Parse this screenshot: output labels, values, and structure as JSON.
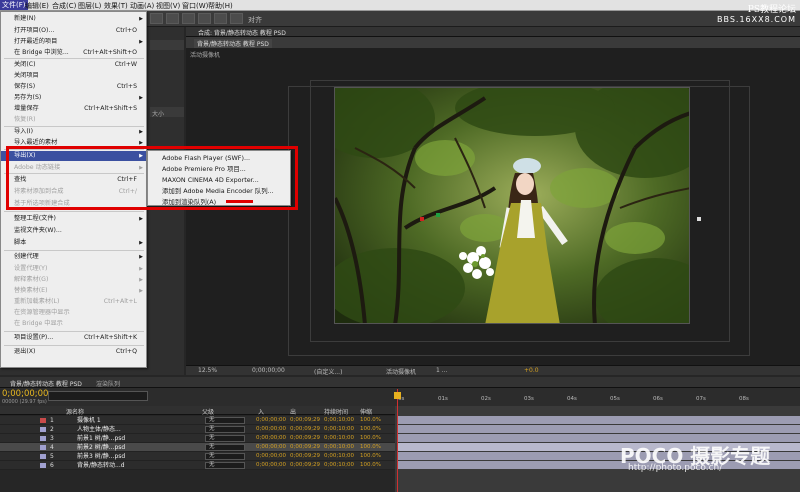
{
  "menubar": {
    "items": [
      "文件(F)",
      "编辑(E)",
      "合成(C)",
      "图层(L)",
      "效果(T)",
      "动画(A)",
      "视图(V)",
      "窗口(W)",
      "帮助(H)"
    ]
  },
  "toolbar": {
    "align_label": "对齐"
  },
  "file_menu": {
    "items": [
      {
        "label": "新建(N)",
        "shortcut": "",
        "submenu": true,
        "disabled": false
      },
      {
        "label": "打开项目(O)...",
        "shortcut": "Ctrl+O",
        "submenu": false,
        "disabled": false
      },
      {
        "label": "打开最近的项目",
        "shortcut": "",
        "submenu": true,
        "disabled": false
      },
      {
        "label": "在 Bridge 中浏览...",
        "shortcut": "Ctrl+Alt+Shift+O",
        "submenu": false,
        "disabled": false
      },
      {
        "label": "关闭(C)",
        "shortcut": "Ctrl+W",
        "submenu": false,
        "disabled": false
      },
      {
        "label": "关闭项目",
        "shortcut": "",
        "submenu": false,
        "disabled": false
      },
      {
        "label": "保存(S)",
        "shortcut": "Ctrl+S",
        "submenu": false,
        "disabled": false
      },
      {
        "label": "另存为(S)",
        "shortcut": "",
        "submenu": true,
        "disabled": false
      },
      {
        "label": "增量保存",
        "shortcut": "Ctrl+Alt+Shift+S",
        "submenu": false,
        "disabled": false
      },
      {
        "label": "恢复(R)",
        "shortcut": "",
        "submenu": false,
        "disabled": true
      },
      {
        "label": "导入(I)",
        "shortcut": "",
        "submenu": true,
        "disabled": false
      },
      {
        "label": "导入最近的素材",
        "shortcut": "",
        "submenu": true,
        "disabled": false
      },
      {
        "label": "导出(X)",
        "shortcut": "",
        "submenu": true,
        "disabled": false,
        "highlighted": true
      },
      {
        "label": "Adobe 动态链接",
        "shortcut": "",
        "submenu": true,
        "disabled": true
      },
      {
        "label": "查找",
        "shortcut": "Ctrl+F",
        "submenu": false,
        "disabled": false
      },
      {
        "label": "将素材添加到合成",
        "shortcut": "Ctrl+/",
        "submenu": false,
        "disabled": true
      },
      {
        "label": "基于所选项新建合成",
        "shortcut": "",
        "submenu": false,
        "disabled": true
      },
      {
        "label": "整理工程(文件)",
        "shortcut": "",
        "submenu": true,
        "disabled": false
      },
      {
        "label": "监视文件夹(W)...",
        "shortcut": "",
        "submenu": false,
        "disabled": false
      },
      {
        "label": "脚本",
        "shortcut": "",
        "submenu": true,
        "disabled": false
      },
      {
        "label": "创建代理",
        "shortcut": "",
        "submenu": true,
        "disabled": false
      },
      {
        "label": "设置代理(Y)",
        "shortcut": "",
        "submenu": true,
        "disabled": true
      },
      {
        "label": "解释素材(G)",
        "shortcut": "",
        "submenu": true,
        "disabled": true
      },
      {
        "label": "替换素材(E)",
        "shortcut": "",
        "submenu": true,
        "disabled": true
      },
      {
        "label": "重新加载素材(L)",
        "shortcut": "Ctrl+Alt+L",
        "submenu": false,
        "disabled": true
      },
      {
        "label": "在资源管理器中显示",
        "shortcut": "",
        "submenu": false,
        "disabled": true
      },
      {
        "label": "在 Bridge 中显示",
        "shortcut": "",
        "submenu": false,
        "disabled": true
      },
      {
        "label": "项目设置(P)...",
        "shortcut": "Ctrl+Alt+Shift+K",
        "submenu": false,
        "disabled": false
      },
      {
        "label": "退出(X)",
        "shortcut": "Ctrl+Q",
        "submenu": false,
        "disabled": false
      }
    ]
  },
  "export_submenu": {
    "items": [
      "Adobe Flash Player (SWF)...",
      "Adobe Premiere Pro 项目...",
      "MAXON CINEMA 4D Exporter...",
      "添加到 Adobe Media Encoder 队列...",
      "添加到渲染队列(A)"
    ]
  },
  "left_panel": {
    "size_label": "大小"
  },
  "composition": {
    "tab_title": "合成: 背景/静态转动态 教程 PSD",
    "subtab_1": "背景/静态转动态 教程 PSD",
    "camera_label": "活动摄像机",
    "zoom": "12.5%",
    "timecode": "0;00;00;00",
    "quality": "(自定义...)",
    "view": "活动摄像机",
    "views_count": "1 ...",
    "exposure": "+0.0"
  },
  "timeline": {
    "tab_title": "背景/静态转动态 教程 PSD",
    "render_tab": "渲染队列",
    "current_time": "0;00;00;00",
    "frames": "00000 (29.97 fps)",
    "columns": {
      "name": "源名称",
      "parent": "父级",
      "in": "入",
      "out": "出",
      "duration": "持续时间",
      "stretch": "伸缩"
    },
    "ruler": [
      "0s",
      "01s",
      "02s",
      "03s",
      "04s",
      "05s",
      "06s",
      "07s",
      "08s"
    ],
    "layers": [
      {
        "num": "1",
        "name": "摄像机 1",
        "color": "#c84a4a",
        "parent": "无",
        "in": "0;00;00;00",
        "out": "0;00;09;29",
        "duration": "0;00;10;00",
        "stretch": "100.0%"
      },
      {
        "num": "2",
        "name": "人物主体/静态...",
        "color": "#a0a0d0",
        "parent": "无",
        "in": "0;00;00;00",
        "out": "0;00;09;29",
        "duration": "0;00;10;00",
        "stretch": "100.0%"
      },
      {
        "num": "3",
        "name": "前景1 树/静...psd",
        "color": "#a0a0d0",
        "parent": "无",
        "in": "0;00;00;00",
        "out": "0;00;09;29",
        "duration": "0;00;10;00",
        "stretch": "100.0%"
      },
      {
        "num": "4",
        "name": "前景2 树/静...psd",
        "color": "#a0a0d0",
        "parent": "无",
        "in": "0;00;00;00",
        "out": "0;00;09;29",
        "duration": "0;00;10;00",
        "stretch": "100.0%"
      },
      {
        "num": "5",
        "name": "前景3 树/静...psd",
        "color": "#a0a0d0",
        "parent": "无",
        "in": "0;00;00;00",
        "out": "0;00;09;29",
        "duration": "0;00;10;00",
        "stretch": "100.0%"
      },
      {
        "num": "6",
        "name": "背景/静态转动...d",
        "color": "#a0a0d0",
        "parent": "无",
        "in": "0;00;00;00",
        "out": "0;00;09;29",
        "duration": "0;00;10;00",
        "stretch": "100.0%"
      }
    ]
  },
  "watermark_top": {
    "line1": "PS教程论坛",
    "line2": "BBS.16XX8.COM"
  },
  "watermark_bottom": {
    "brand": "POCO 摄影专题",
    "url": "http://photo.poco.cn/"
  }
}
